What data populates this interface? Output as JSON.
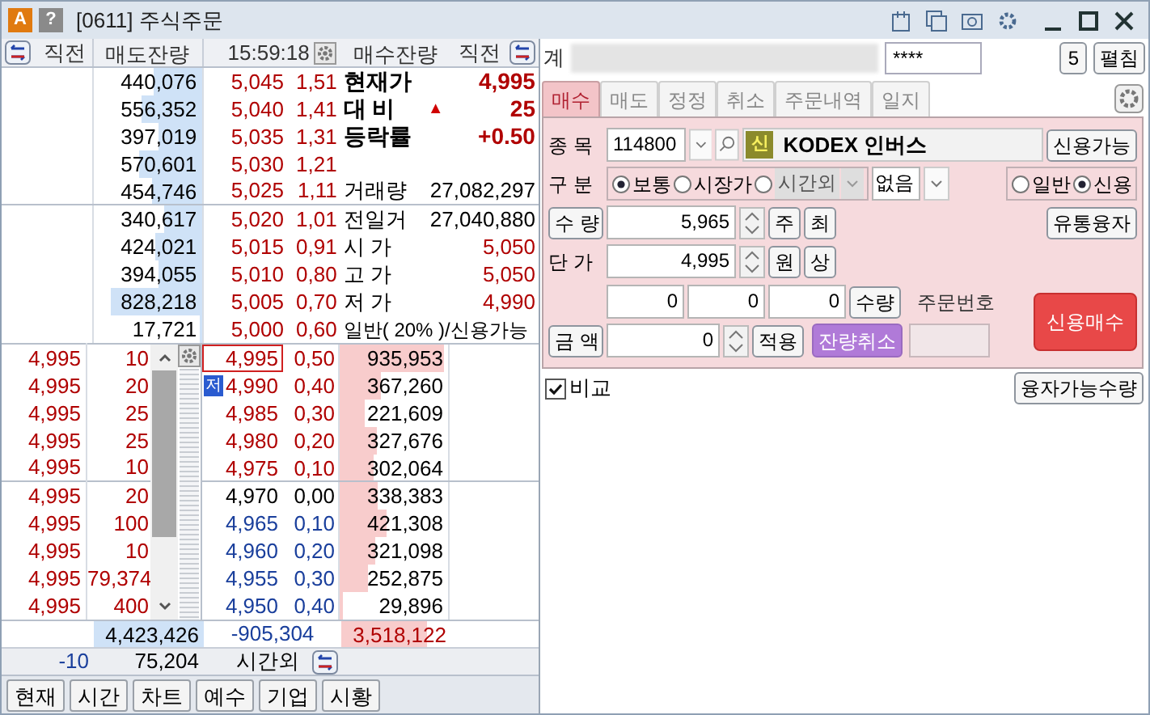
{
  "window": {
    "title": "[0611] 주식주문",
    "badges": [
      "A",
      "?"
    ]
  },
  "orderbook": {
    "header": {
      "prev_left": "직전",
      "ask_qty": "매도잔량",
      "time": "15:59:18",
      "bid_qty": "매수잔량",
      "prev_right": "직전"
    },
    "asks": [
      {
        "qty": "440,076",
        "price": "5,045",
        "rate": "1,51",
        "info": {
          "kind": "headline",
          "label": "현재가",
          "value": "4,995",
          "color": "#b00000"
        }
      },
      {
        "qty": "556,352",
        "price": "5,040",
        "rate": "1,41",
        "info": {
          "kind": "headline",
          "label": "대 비",
          "sign": "▲",
          "value": "25",
          "color": "#b00000"
        }
      },
      {
        "qty": "397,019",
        "price": "5,035",
        "rate": "1,31",
        "info": {
          "kind": "headline",
          "label": "등락률",
          "value": "+0.50",
          "color": "#b00000"
        }
      },
      {
        "qty": "570,601",
        "price": "5,030",
        "rate": "1,21"
      },
      {
        "qty": "454,746",
        "price": "5,025",
        "rate": "1,11",
        "info": {
          "kind": "stat",
          "label": "거래량",
          "value": "27,082,297",
          "color": "#000000"
        }
      },
      {
        "qty": "340,617",
        "price": "5,020",
        "rate": "1,01",
        "info": {
          "kind": "stat",
          "label": "전일거",
          "value": "27,040,880",
          "color": "#000000"
        }
      },
      {
        "qty": "424,021",
        "price": "5,015",
        "rate": "0,91",
        "info": {
          "kind": "stat",
          "label": "시 가",
          "value": "5,050",
          "color": "#b00000"
        }
      },
      {
        "qty": "394,055",
        "price": "5,010",
        "rate": "0,80",
        "info": {
          "kind": "stat",
          "label": "고 가",
          "value": "5,050",
          "color": "#b00000"
        }
      },
      {
        "qty": "828,218",
        "price": "5,005",
        "rate": "0,70",
        "info": {
          "kind": "stat",
          "label": "저 가",
          "value": "4,990",
          "color": "#b00000"
        }
      },
      {
        "qty": "17,721",
        "price": "5,000",
        "rate": "0,60",
        "info": {
          "kind": "note",
          "label": "일반( 20% )/신용가능"
        }
      }
    ],
    "bids": [
      {
        "prev": "4,995",
        "prev_qty": "10",
        "price": "4,995",
        "rate": "0,50",
        "qty": "935,953",
        "color": "#b00000",
        "current": true
      },
      {
        "prev": "4,995",
        "prev_qty": "20",
        "marker": "저",
        "price": "4,990",
        "rate": "0,40",
        "qty": "367,260",
        "color": "#b00000",
        "current": false
      },
      {
        "prev": "4,995",
        "prev_qty": "25",
        "price": "4,985",
        "rate": "0,30",
        "qty": "221,609",
        "color": "#b00000",
        "current": false
      },
      {
        "prev": "4,995",
        "prev_qty": "25",
        "price": "4,980",
        "rate": "0,20",
        "qty": "327,676",
        "color": "#b00000",
        "current": false
      },
      {
        "prev": "4,995",
        "prev_qty": "10",
        "price": "4,975",
        "rate": "0,10",
        "qty": "302,064",
        "color": "#b00000",
        "current": false
      },
      {
        "prev": "4,995",
        "prev_qty": "20",
        "price": "4,970",
        "rate": "0,00",
        "qty": "338,383",
        "color": "#000000",
        "current": false
      },
      {
        "prev": "4,995",
        "prev_qty": "100",
        "price": "4,965",
        "rate": "0,10",
        "qty": "421,308",
        "color": "#1a3f9c",
        "current": false
      },
      {
        "prev": "4,995",
        "prev_qty": "10",
        "price": "4,960",
        "rate": "0,20",
        "qty": "321,098",
        "color": "#1a3f9c",
        "current": false
      },
      {
        "prev": "4,995",
        "prev_qty": "79,374",
        "price": "4,955",
        "rate": "0,30",
        "qty": "252,875",
        "color": "#1a3f9c",
        "current": false
      },
      {
        "prev": "4,995",
        "prev_qty": "400",
        "price": "4,950",
        "rate": "0,40",
        "qty": "29,896",
        "color": "#1a3f9c",
        "current": false
      }
    ],
    "totals": {
      "ask_total": "4,423,426",
      "diff": "-905,304",
      "bid_total": "3,518,122"
    },
    "after_hours": {
      "change": "-10",
      "qty": "75,204",
      "label": "시간외"
    }
  },
  "bottom_tabs": [
    "현재",
    "시간",
    "차트",
    "예수",
    "기업",
    "시황"
  ],
  "order": {
    "account_label": "계",
    "password": "****",
    "count_button": "5",
    "expand_button": "펼침",
    "tabs": [
      {
        "label": "매수",
        "selected": true
      },
      {
        "label": "매도",
        "selected": false
      },
      {
        "label": "정정",
        "selected": false
      },
      {
        "label": "취소",
        "selected": false
      },
      {
        "label": "주문내역",
        "selected": false
      },
      {
        "label": "일지",
        "selected": false
      }
    ],
    "symbol": {
      "label": "종 목",
      "code": "114800",
      "badge": "신",
      "name": "KODEX 인버스",
      "button": "신용가능"
    },
    "type_label": "구 분",
    "order_types": [
      {
        "label": "보통",
        "selected": true,
        "kind": "radio"
      },
      {
        "label": "시장가",
        "selected": false,
        "kind": "radio"
      },
      {
        "label": "시간외",
        "selected": false,
        "kind": "dropdown",
        "disabled": true
      }
    ],
    "condition": "없음",
    "credit": [
      {
        "label": "일반",
        "selected": false
      },
      {
        "label": "신용",
        "selected": true
      }
    ],
    "quantity": {
      "label": "수 량",
      "value": "5,965",
      "buttons": [
        "주",
        "최"
      ]
    },
    "loan_button": "유통융자",
    "price": {
      "label": "단 가",
      "value": "4,995",
      "buttons": [
        "원",
        "상"
      ]
    },
    "split": {
      "values": [
        "0",
        "0",
        "0"
      ],
      "button": "수량"
    },
    "order_no_label": "주문번호",
    "amount": {
      "label": "금 액",
      "value": "0",
      "button": "적용"
    },
    "cancel_rest": "잔량취소",
    "submit": "신용매수",
    "compare": {
      "label": "비교",
      "checked": true
    },
    "loan_qty_button": "융자가능수량"
  }
}
